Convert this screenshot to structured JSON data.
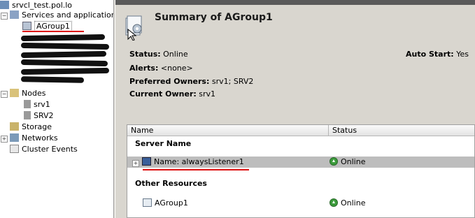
{
  "tree": {
    "root_label": "srvcl_test.pol.lo",
    "services_label": "Services and applications",
    "selected_label": "AGroup1",
    "nodes_label": "Nodes",
    "node_items": [
      "srv1",
      "SRV2"
    ],
    "storage_label": "Storage",
    "networks_label": "Networks",
    "events_label": "Cluster Events"
  },
  "summary": {
    "title": "Summary of AGroup1",
    "status_key": "Status:",
    "status_value": "Online",
    "alerts_key": "Alerts:",
    "alerts_value": "<none>",
    "preferred_key": "Preferred Owners:",
    "preferred_value": "srv1; SRV2",
    "owner_key": "Current Owner:",
    "owner_value": "srv1",
    "autostart_key": "Auto Start:",
    "autostart_value": "Yes"
  },
  "grid": {
    "col_name": "Name",
    "col_status": "Status",
    "server_section": "Server Name",
    "server_row_name": "Name: alwaysListener1",
    "server_row_status": "Online",
    "other_section": "Other Resources",
    "other_row_name": "AGroup1",
    "other_row_status": "Online"
  },
  "colors": {
    "accent_red": "#dd1111",
    "online_green": "#3b9b3b",
    "pane_bg": "#d9d6cf"
  }
}
